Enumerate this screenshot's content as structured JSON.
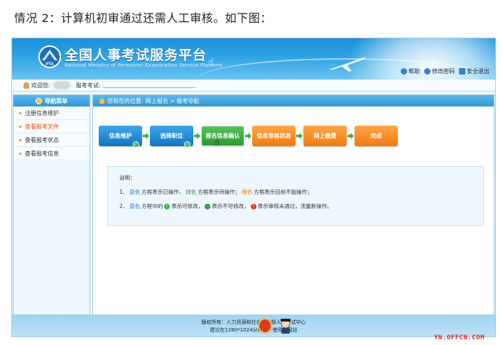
{
  "caption": "情况 2：计算机初审通过还需人工审核。如下图：",
  "header": {
    "title": "全国人事考试服务平台",
    "subtitle": "National Ministry of Personnel Examination Service Platform",
    "logo_text": "PTA",
    "links": [
      {
        "label": "帮助",
        "icon": "help-icon",
        "color": "#3a7fcf"
      },
      {
        "label": "修改密码",
        "icon": "key-icon",
        "color": "#3a7fcf"
      },
      {
        "label": "安全退出",
        "icon": "exit-icon",
        "color": "#3a7fcf"
      }
    ]
  },
  "userbar": {
    "welcome": "欢迎您:",
    "exam_label": "报考考试:"
  },
  "sidebar": {
    "title": "导航菜单",
    "items": [
      {
        "label": "注册信息维护",
        "active": false
      },
      {
        "label": "查看报考文件",
        "active": true
      },
      {
        "label": "查看报考状态",
        "active": false
      },
      {
        "label": "查看报考信息",
        "active": false
      }
    ]
  },
  "breadcrumb": {
    "prefix": "您现在的位置:",
    "path": "网上报名 > 报考导航"
  },
  "steps": [
    {
      "label": "信息维护",
      "state": "blue",
      "done": true
    },
    {
      "label": "选择职位",
      "state": "blue",
      "done": true
    },
    {
      "label": "报名信息确认",
      "state": "green",
      "done": false
    },
    {
      "label": "信息审核状态",
      "state": "orange",
      "done": false
    },
    {
      "label": "网上缴费",
      "state": "orange",
      "done": false
    },
    {
      "label": "完成",
      "state": "orange",
      "done": false
    }
  ],
  "notes": {
    "title": "说明：",
    "line1": {
      "num": "1、",
      "blue": "蓝色",
      "t1": "方框表示已操作，",
      "green": "绿色",
      "t2": "方框表示待操作；",
      "orange": "橙色",
      "t3": "方框表示目前不能操作；"
    },
    "line2": {
      "num": "2、",
      "blue": "蓝色",
      "t1": "方框中的",
      "t2": "表示可修改，",
      "t3": "表示不可修改，",
      "t4": "表示审核未通过，须重新操作。"
    }
  },
  "footer": {
    "line1": "版权所有：人力资源和社会保障部人事考试中心",
    "line2": "建议在1280*1024分辨率下使用本网站"
  },
  "watermark": "YN.OFFCN.COM",
  "colors": {
    "header_blue": "#1a8fd6",
    "step_blue": "#1276c4",
    "step_green": "#2b9a33",
    "step_orange": "#f47a12",
    "active_menu": "#e84b19"
  }
}
